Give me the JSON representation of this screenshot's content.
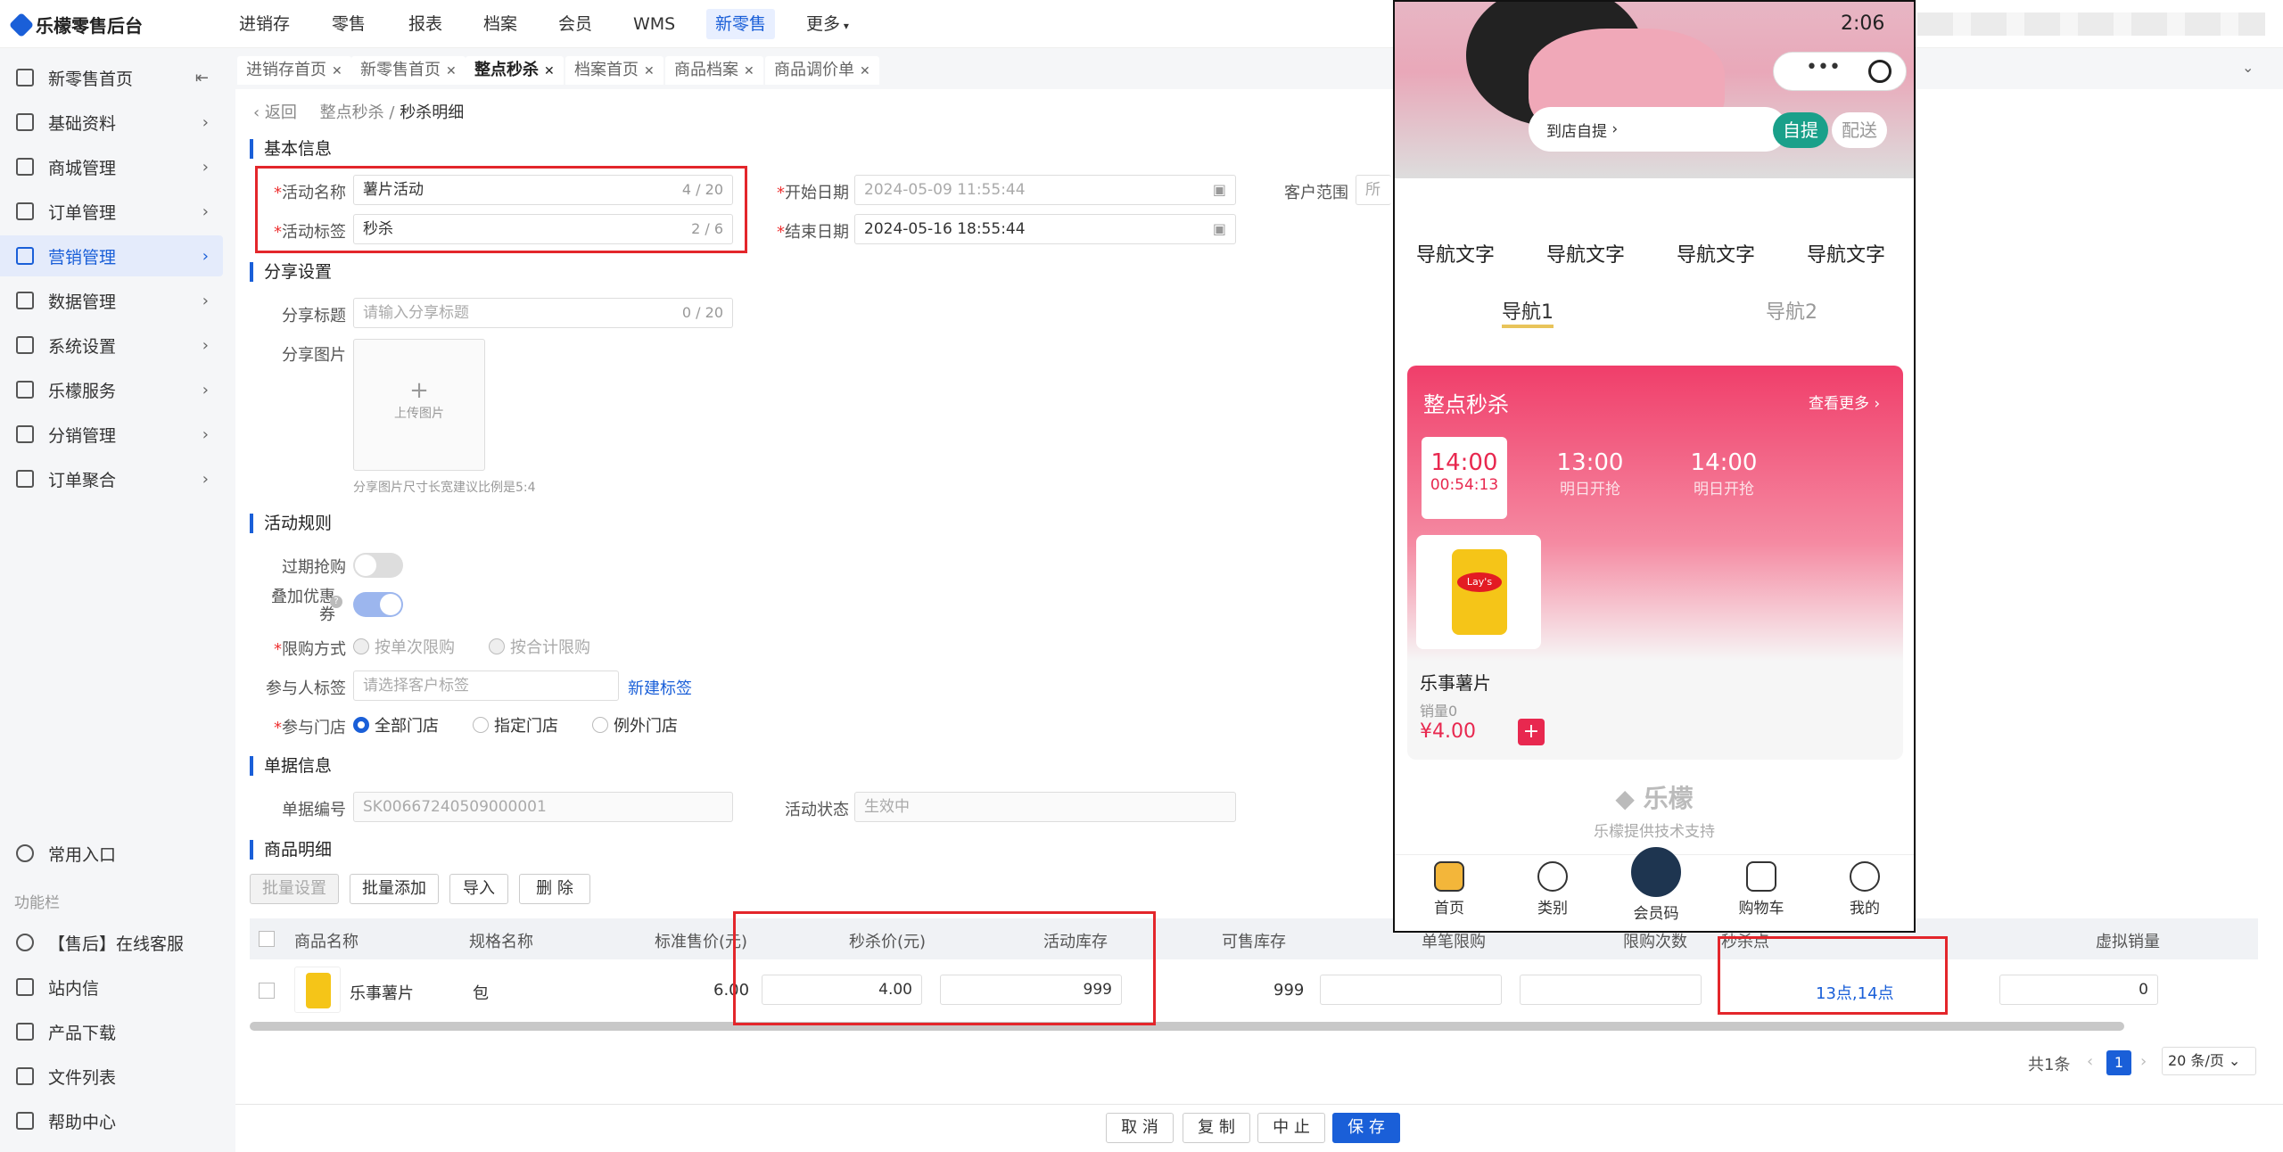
{
  "app": {
    "title": "乐檬零售后台"
  },
  "topnav": [
    "进销存",
    "零售",
    "报表",
    "档案",
    "会员",
    "WMS",
    "新零售",
    "更多"
  ],
  "sidebar": {
    "items": [
      {
        "label": "新零售首页",
        "icon": "home-icon"
      },
      {
        "label": "基础资料",
        "icon": "grid-icon"
      },
      {
        "label": "商城管理",
        "icon": "shop-icon"
      },
      {
        "label": "订单管理",
        "icon": "order-icon"
      },
      {
        "label": "营销管理",
        "icon": "marketing-icon"
      },
      {
        "label": "数据管理",
        "icon": "chart-icon"
      },
      {
        "label": "系统设置",
        "icon": "gear-icon"
      },
      {
        "label": "乐檬服务",
        "icon": "service-icon"
      },
      {
        "label": "分销管理",
        "icon": "distribution-icon"
      },
      {
        "label": "订单聚合",
        "icon": "aggregate-icon"
      }
    ],
    "common": "常用入口",
    "function_bar": "功能栏",
    "bottom": [
      "【售后】在线客服",
      "站内信",
      "产品下载",
      "文件列表",
      "帮助中心"
    ]
  },
  "tabs": [
    "进销存首页",
    "新零售首页",
    "整点秒杀",
    "档案首页",
    "商品档案",
    "商品调价单"
  ],
  "breadcrumb": {
    "back": "返回",
    "parent": "整点秒杀",
    "sep": "/",
    "current": "秒杀明细"
  },
  "basic": {
    "section": "基本信息",
    "name_label": "活动名称",
    "name_value": "薯片活动",
    "name_count": "4 / 20",
    "tag_label": "活动标签",
    "tag_value": "秒杀",
    "tag_count": "2 / 6",
    "start_label": "开始日期",
    "start_value": "2024-05-09 11:55:44",
    "end_label": "结束日期",
    "end_value": "2024-05-16 18:55:44",
    "customer_label": "客户范围",
    "customer_value": "所有"
  },
  "share": {
    "section": "分享设置",
    "title_label": "分享标题",
    "title_placeholder": "请输入分享标题",
    "title_count": "0 / 20",
    "image_label": "分享图片",
    "upload": "上传图片",
    "hint": "分享图片尺寸长宽建议比例是5:4"
  },
  "rules": {
    "section": "活动规则",
    "expire_label": "过期抢购",
    "expire_on": false,
    "coupon_label": "叠加优惠券",
    "coupon_on": true,
    "limit_label": "限购方式",
    "limit_options": [
      "按单次限购",
      "按合计限购"
    ],
    "tag_label": "参与人标签",
    "tag_placeholder": "请选择客户标签",
    "new_tag": "新建标签",
    "store_label": "参与门店",
    "store_options": [
      "全部门店",
      "指定门店",
      "例外门店"
    ],
    "store_selected": "全部门店"
  },
  "doc": {
    "section": "单据信息",
    "no_label": "单据编号",
    "no_value": "SK00667240509000001",
    "status_label": "活动状态",
    "status_value": "生效中"
  },
  "goods": {
    "section": "商品明细",
    "buttons": [
      "批量设置",
      "批量添加",
      "导入",
      "删 除"
    ],
    "columns": [
      "商品名称",
      "规格名称",
      "标准售价(元)",
      "秒杀价(元)",
      "活动库存",
      "可售库存",
      "单笔限购",
      "限购次数",
      "秒杀点",
      "虚拟销量"
    ],
    "rows": [
      {
        "name": "乐事薯片",
        "spec": "包",
        "price": "6.00",
        "seckill": "4.00",
        "stock": "999",
        "available": "999",
        "single": "",
        "times": "",
        "points": "13点,14点",
        "virtual": "0"
      }
    ]
  },
  "pagination": {
    "total": "共1条",
    "page": "1",
    "size": "20 条/页"
  },
  "footer": {
    "cancel": "取 消",
    "copy": "复 制",
    "stop": "中 止",
    "save": "保 存"
  },
  "phone": {
    "time": "2:06",
    "pickup_text": "到店自提",
    "pickup": "自提",
    "delivery": "配送",
    "nav_words": [
      "导航文字",
      "导航文字",
      "导航文字",
      "导航文字"
    ],
    "nav_tabs": [
      "导航1",
      "导航2"
    ],
    "seckill": {
      "title": "整点秒杀",
      "more": "查看更多",
      "slots": [
        {
          "time": "14:00",
          "sub": "00:54:13"
        },
        {
          "time": "13:00",
          "sub": "明日开抢"
        },
        {
          "time": "14:00",
          "sub": "明日开抢"
        }
      ],
      "product": {
        "name": "乐事薯片",
        "sales": "销量0",
        "price": "¥4.00",
        "bag_text": "Lay's"
      }
    },
    "brand": "乐檬",
    "brand_sub": "乐檬提供技术支持",
    "tabbar": [
      "首页",
      "类别",
      "会员码",
      "购物车",
      "我的"
    ]
  },
  "colors": {
    "accent": "#1a5fd8",
    "highlight": "#e3262b",
    "seckill": "#f03e6a"
  }
}
